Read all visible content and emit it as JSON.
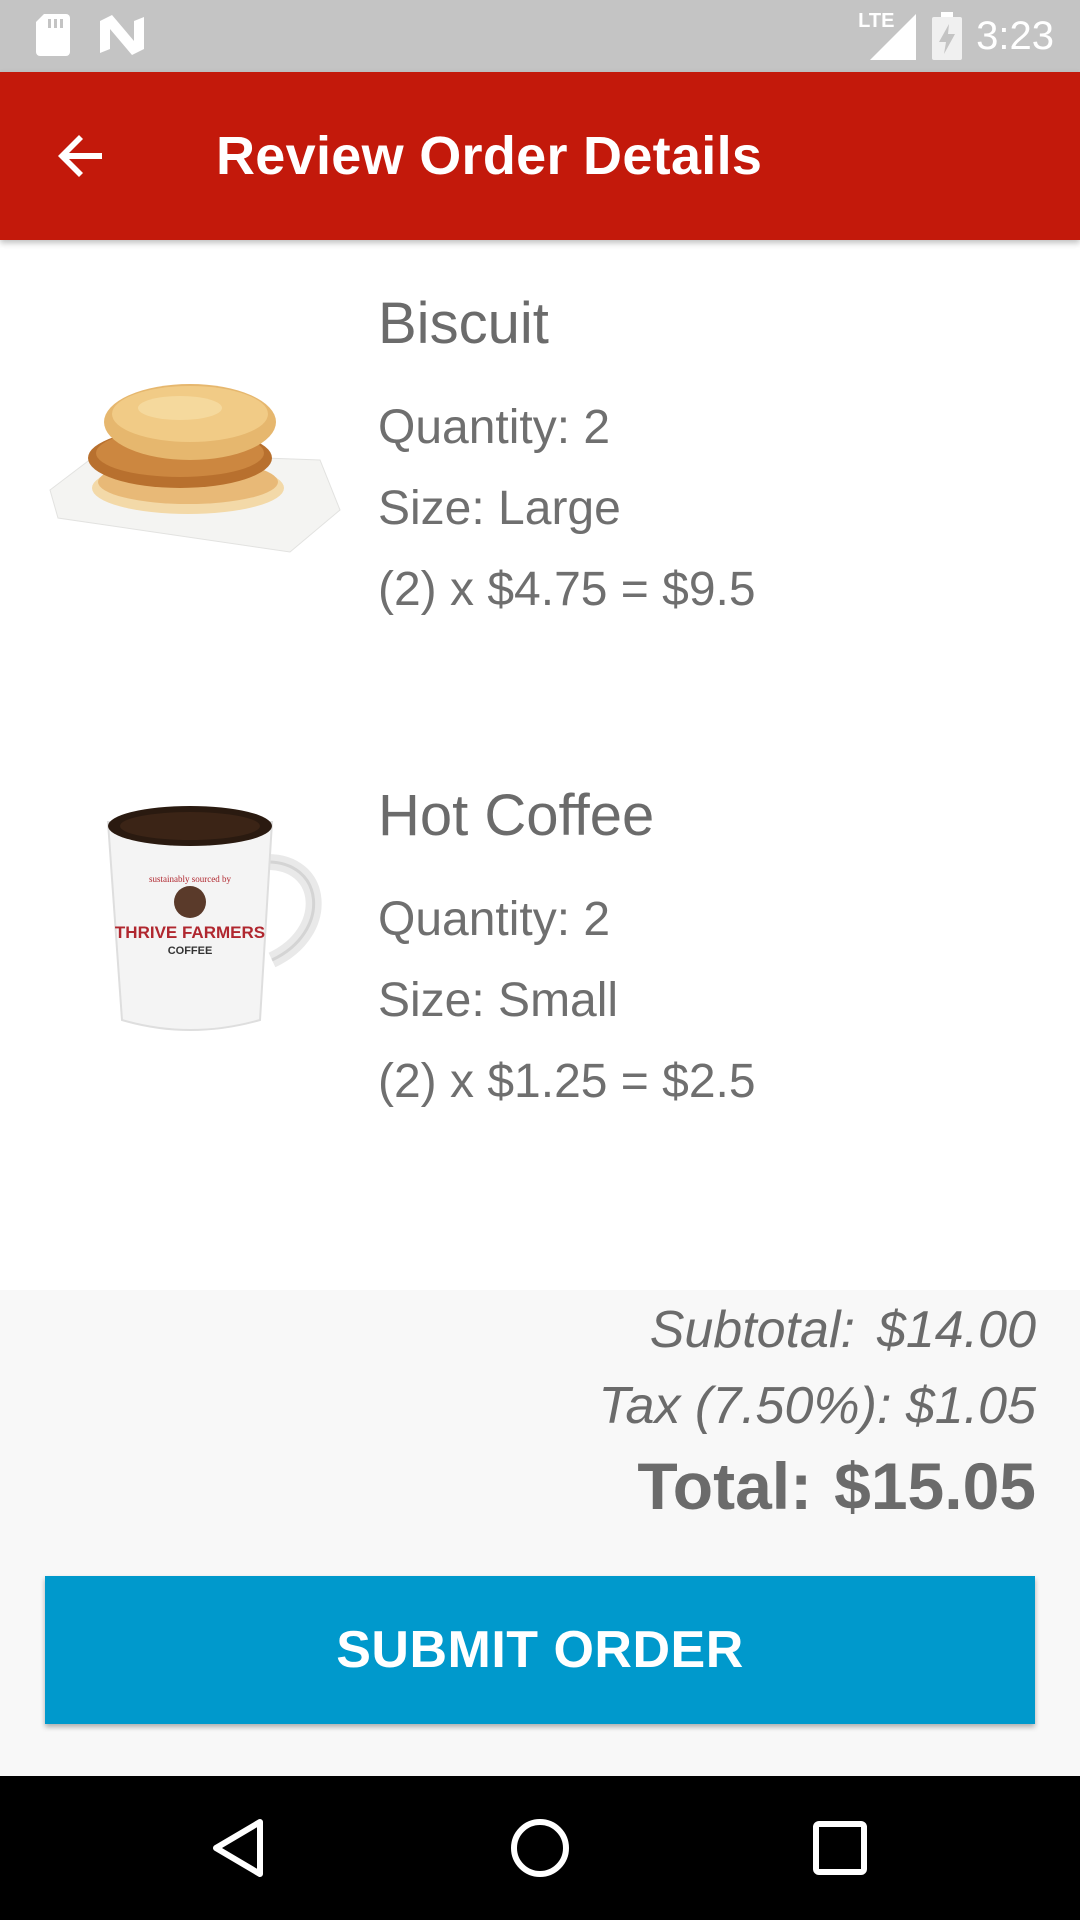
{
  "status_bar": {
    "time": "3:23",
    "network": "LTE",
    "icons": [
      "sd-card-icon",
      "n-logo-icon",
      "signal-icon",
      "battery-charging-icon"
    ]
  },
  "app_bar": {
    "title": "Review Order Details",
    "back_icon": "arrow-back-icon"
  },
  "order_items": [
    {
      "name": "Biscuit",
      "quantity": "Quantity: 2",
      "size": "Size: Large",
      "price_line": "(2) x $4.75 = $9.5",
      "image": "chicken-biscuit-image"
    },
    {
      "name": "Hot Coffee",
      "quantity": "Quantity: 2",
      "size": "Size: Small",
      "price_line": "(2) x $1.25 = $2.5",
      "image": "coffee-mug-image",
      "mug_text": {
        "arc": "sustainably sourced by",
        "brand": "THRIVE FARMERS",
        "sub": "COFFEE"
      }
    }
  ],
  "summary": {
    "subtotal_label": "Subtotal:",
    "subtotal_value": "$14.00",
    "tax_label": "Tax (7.50%):",
    "tax_value": "$1.05",
    "total_label": "Total:",
    "total_value": "$15.05"
  },
  "submit_label": "SUBMIT ORDER",
  "colors": {
    "app_bar": "#c3190b",
    "submit": "#0099cc",
    "status_bar": "#c4c4c4",
    "text": "#6b6b6b"
  },
  "nav_bar": {
    "icons": [
      "back-triangle-icon",
      "home-circle-icon",
      "recents-square-icon"
    ]
  }
}
